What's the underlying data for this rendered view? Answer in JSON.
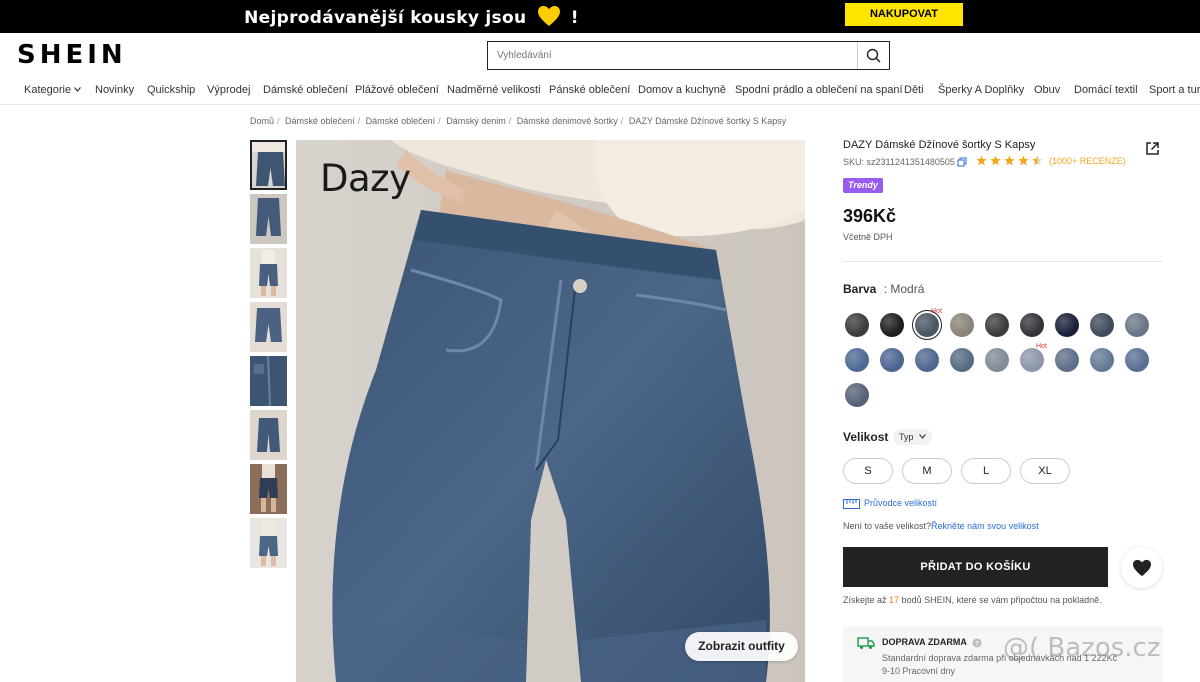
{
  "promo": {
    "text_before": "Nejprodávanější kousky jsou",
    "text_after": "!",
    "heart_icon": "yellow-heart-icon",
    "button_label": "NAKUPOVAT",
    "accent": "#ffe500"
  },
  "header": {
    "logo": "SHEIN",
    "search_placeholder": "Vyhledávání",
    "search_icon": "search-icon"
  },
  "nav": {
    "items": [
      "Kategorie",
      "Novinky",
      "Quickship",
      "Výprodej",
      "Dámské oblečení",
      "Plážové oblečení",
      "Nadměrné velikosti",
      "Pánské oblečení",
      "Domov a kuchyně",
      "Spodní prádlo a oblečení na spaní",
      "Děti",
      "Šperky A Doplňky",
      "Obuv",
      "Domácí textil",
      "Sport a turi"
    ]
  },
  "breadcrumb": [
    "Domů",
    "Dámské oblečení",
    "Dámské oblečení",
    "Dámský denim",
    "Dámské denimové šortky",
    "DAZY Dámské Džínové šortky S Kapsy"
  ],
  "gallery": {
    "brand_mark": "Dazy",
    "outfit_button": "Zobrazit outfity",
    "thumbnail_count": 8
  },
  "product": {
    "title": "DAZY Dámské Džínové šortky S Kapsy",
    "sku": "SKU: sz2311241351480505",
    "rating": 4.5,
    "reviews": "(1000+ RECENZE)",
    "badge": "Trendy",
    "price": "396Kč",
    "vat_note": "Včetně DPH",
    "color_label": "Barva",
    "color_value": ": Modrá",
    "colors": [
      "#3b3b3d",
      "#1e1e20",
      "#4a5663",
      "#8a8478",
      "#3c3c3c",
      "#333438",
      "#1a2038",
      "#3f4a5c",
      "#6a7688",
      "#4f6a95",
      "#4d6592",
      "#50688f",
      "#566c82",
      "#7f8b98",
      "#8d97a8",
      "#5f6f8a",
      "#647a93",
      "#5b6f95",
      "#566277"
    ],
    "selected_color_index": 2,
    "hot_label": "Hot",
    "hot_indices": [
      2,
      14
    ],
    "size_label": "Velikost",
    "size_type": "Typ",
    "sizes": [
      "S",
      "M",
      "L",
      "XL"
    ],
    "size_guide": "Průvodce velikostí",
    "fit_question": "Není to vaše velikost?",
    "fit_link": "Řekněte nám svou velikost",
    "add_to_cart": "PŘIDAT DO KOŠÍKU",
    "points_before": "Získejte až",
    "points_value": "17",
    "points_after": "bodů SHEIN, které se vám připočtou na pokladně.",
    "shipping_title": "DOPRAVA ZDARMA",
    "shipping_line1": "Standardní doprava zdarma při objednávkách nad 1 222Kč",
    "shipping_line2": "9-10 Pracovní dny"
  },
  "watermark": "@( Bazos.cz"
}
